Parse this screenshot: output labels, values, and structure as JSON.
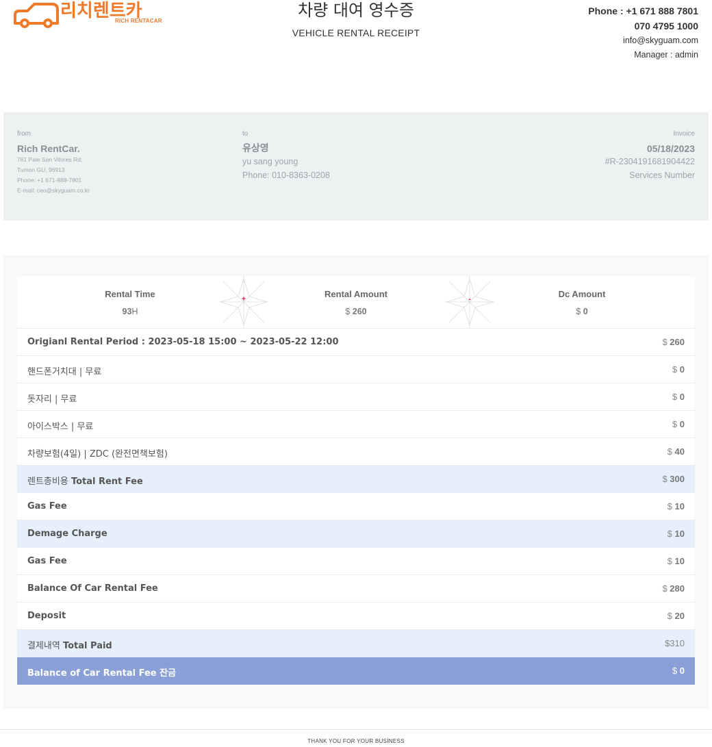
{
  "header": {
    "logo_ko": "리치렌트카",
    "logo_en": "RICH RENTACAR",
    "title_ko": "차량 대여 영수증",
    "title_en": "VEHICLE RENTAL RECEIPT",
    "phone": "Phone : +1 671 888 7801",
    "phone2": "070 4795 1000",
    "email": "info@skyguam.com",
    "manager": "Manager : admin",
    "brand_color": "#ee7a2a"
  },
  "from": {
    "label": "from",
    "name": "Rich RentCar.",
    "address1": "761 Pale San Vitores Rd,",
    "address2": "Tumon GU, 96913",
    "phone": "Phone: +1 671-888-7801",
    "email": "E-mail: ceo@skyguam.co.kr"
  },
  "to": {
    "label": "to",
    "name_ko": "유상영",
    "name_en": "yu sang young",
    "phone": "Phone: 010-8363-0208"
  },
  "invoice": {
    "label": "Invoice",
    "date": "05/18/2023",
    "number": "#R-2304191681904422",
    "number_label": "Services Number"
  },
  "summary": {
    "rental_time": {
      "label": "Rental Time",
      "value": "93",
      "unit": "H"
    },
    "plus": "+",
    "rental_amount": {
      "label": "Rental Amount",
      "currency": "$",
      "value": "260"
    },
    "minus": "-",
    "dc_amount": {
      "label": "Dc Amount",
      "currency": "$",
      "value": "0"
    }
  },
  "rows": [
    {
      "label": "Origianl Rental Period : 2023-05-18 15:00 ~ 2023-05-22 12:00",
      "currency": "$",
      "amount": "260",
      "style": "bold"
    },
    {
      "label": "핸드폰거치대 | 무료",
      "currency": "$",
      "amount": "0",
      "style": "normal"
    },
    {
      "label": "돗자리 | 무료",
      "currency": "$",
      "amount": "0",
      "style": "normal"
    },
    {
      "label": "아이스박스 | 무료",
      "currency": "$",
      "amount": "0",
      "style": "normal"
    },
    {
      "label": "차량보험(4일) | ZDC (완전면책보험)",
      "currency": "$",
      "amount": "40",
      "style": "normal"
    },
    {
      "label_ko": "렌트총비용 ",
      "label": "Total Rent Fee",
      "currency": "$",
      "amount": "300",
      "style": "hl"
    },
    {
      "label": "Gas Fee",
      "currency": "$",
      "amount": "10",
      "style": "bold"
    },
    {
      "label": "Demage Charge",
      "currency": "$",
      "amount": "10",
      "style": "hl"
    },
    {
      "label": "Gas Fee",
      "currency": "$",
      "amount": "10",
      "style": "bold"
    },
    {
      "label": "Balance Of Car Rental Fee",
      "currency": "$",
      "amount": "280",
      "style": "bold"
    },
    {
      "label": "Deposit",
      "currency": "$",
      "amount": "20",
      "style": "bold"
    },
    {
      "label_ko": "결제내역 ",
      "label": "Total Paid",
      "currency": "$",
      "amount": "310",
      "style": "hl"
    },
    {
      "label": "Balance of Car Rental Fee 잔금",
      "currency": "$",
      "amount": "0",
      "style": "final"
    }
  ],
  "footer": {
    "text": "THANK YOU FOR YOUR BUSINESS"
  },
  "colors": {
    "highlight_row": "#e5f0fc",
    "final_row": "#8a9fd5",
    "operator": "#d6245a"
  }
}
